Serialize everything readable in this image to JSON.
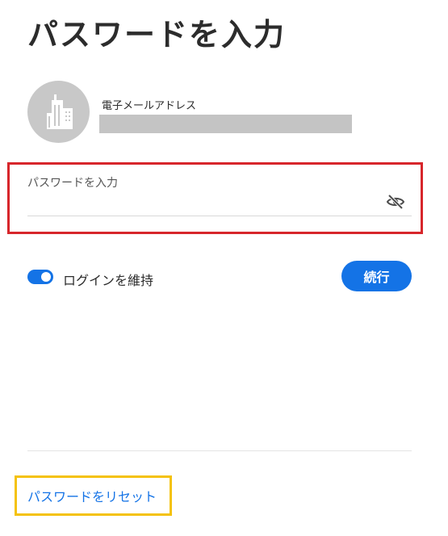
{
  "page": {
    "title": "パスワードを入力"
  },
  "account": {
    "avatar_icon": "building-icon",
    "email_label": "電子メールアドレス",
    "email_value": ""
  },
  "password": {
    "label": "パスワードを入力",
    "value": "",
    "visibility_icon": "eye-slash-icon"
  },
  "options": {
    "keep_signed_in_label": "ログインを維持",
    "keep_signed_in": true
  },
  "actions": {
    "continue_label": "続行",
    "reset_password_label": "パスワードをリセット"
  },
  "colors": {
    "accent": "#1473e6",
    "highlight_red": "#d7262b",
    "highlight_yellow": "#f4c20d",
    "avatar_bg": "#c8c8c8"
  }
}
